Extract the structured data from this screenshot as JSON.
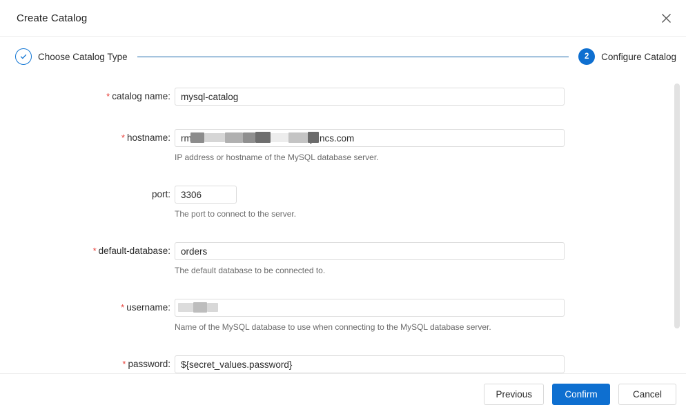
{
  "dialog": {
    "title": "Create Catalog",
    "close_icon": "close-icon"
  },
  "stepper": {
    "steps": [
      {
        "marker": "✓",
        "label": "Choose Catalog Type",
        "state": "done"
      },
      {
        "marker": "2",
        "label": "Configure Catalog",
        "state": "active"
      }
    ],
    "line_color": "#1565a8",
    "active_color": "#0e6fd0"
  },
  "form": {
    "fields": [
      {
        "label": "catalog name:",
        "required": true,
        "value": "mysql-catalog",
        "placeholder": "",
        "help": "",
        "redacted": false,
        "narrow": false
      },
      {
        "label": "hostname:",
        "required": true,
        "value": "rm-                                 l.rds.aliyuncs.com",
        "placeholder": "",
        "help": "IP address or hostname of the MySQL database server.",
        "redacted": true,
        "narrow": false
      },
      {
        "label": "port:",
        "required": false,
        "value": "3306",
        "placeholder": "",
        "help": "The port to connect to the server.",
        "redacted": false,
        "narrow": true
      },
      {
        "label": "default-database:",
        "required": true,
        "value": "orders",
        "placeholder": "",
        "help": "The default database to be connected to.",
        "redacted": false,
        "narrow": false
      },
      {
        "label": "username:",
        "required": true,
        "value": "",
        "placeholder": "",
        "help": "Name of the MySQL database to use when connecting to the MySQL database server.",
        "redacted": true,
        "narrow": false
      },
      {
        "label": "password:",
        "required": true,
        "value": "${secret_values.password}",
        "placeholder": "",
        "help": "",
        "redacted": false,
        "narrow": false
      }
    ]
  },
  "footer": {
    "previous_label": "Previous",
    "confirm_label": "Confirm",
    "cancel_label": "Cancel",
    "primary_color": "#0e6fd0"
  }
}
